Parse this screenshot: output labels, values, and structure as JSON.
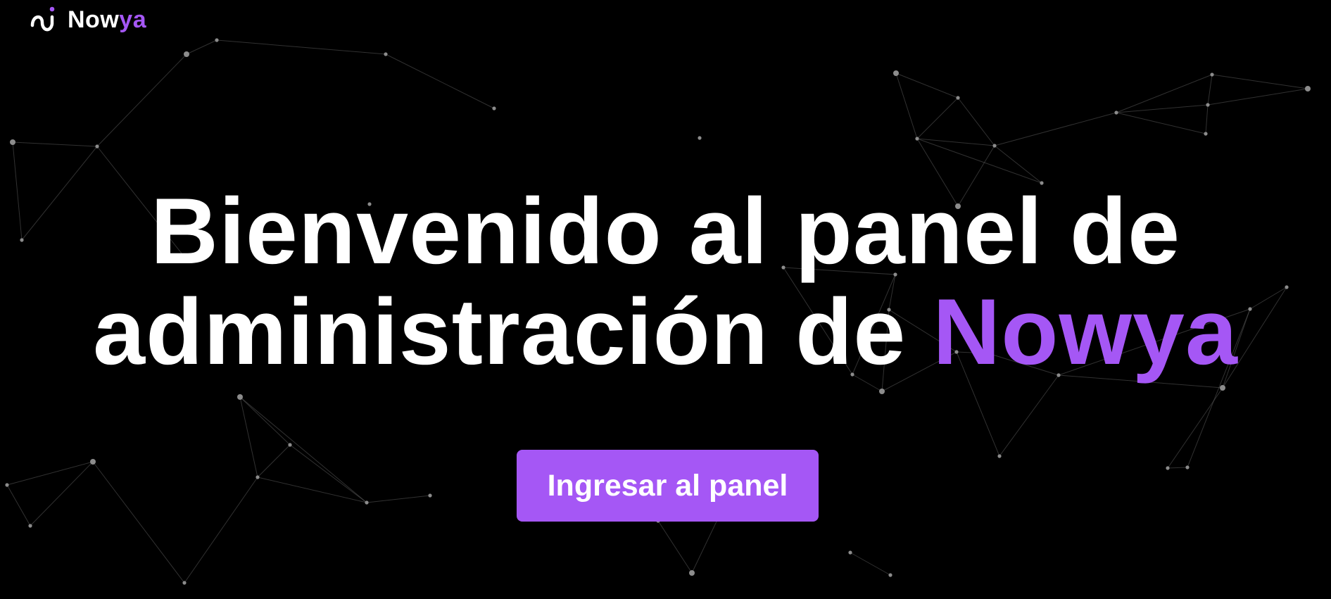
{
  "brand": {
    "name_part1": "Now",
    "name_part2": "ya",
    "icon": "nowya-logo-icon",
    "accent_color": "#a557f5"
  },
  "hero": {
    "title_line1": "Bienvenido al panel de",
    "title_line2_prefix": "administración de",
    "title_brand": "Nowya"
  },
  "cta": {
    "label": "Ingresar al panel"
  },
  "colors": {
    "background": "#000000",
    "text": "#ffffff",
    "accent": "#a557f5",
    "network_lines": "#5a5a5a",
    "network_nodes": "#8c8c8c"
  },
  "background": {
    "decoration": "particle-network"
  }
}
